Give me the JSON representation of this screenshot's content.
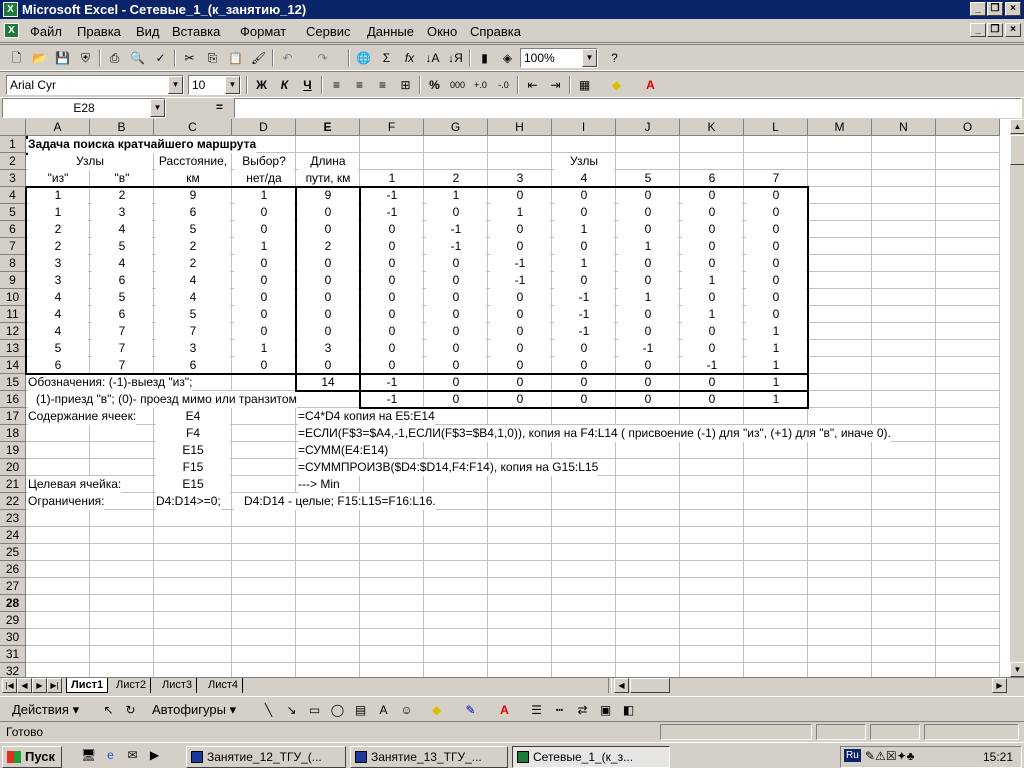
{
  "window": {
    "title": "Microsoft Excel - Сетевые_1_(к_занятию_12)",
    "app_icon": "excel-icon",
    "controls": [
      "_",
      "❐",
      "×"
    ]
  },
  "menu": [
    "Файл",
    "Правка",
    "Вид",
    "Вставка",
    "Формат",
    "Сервис",
    "Данные",
    "Окно",
    "Справка"
  ],
  "toolbar": {
    "zoom": "100%"
  },
  "format_toolbar": {
    "font": "Arial Cyr",
    "size": "10",
    "bold": "Ж",
    "italic": "К",
    "underline": "Ч",
    "percent": "%",
    "thousands": "000"
  },
  "formula_bar": {
    "name_box": "E28",
    "equals": "=",
    "content": ""
  },
  "columns": [
    "A",
    "B",
    "C",
    "D",
    "E",
    "F",
    "G",
    "H",
    "I",
    "J",
    "K",
    "L",
    "M",
    "N",
    "O"
  ],
  "selected_column": "E",
  "selected_row": "28",
  "rows": [
    "1",
    "2",
    "3",
    "4",
    "5",
    "6",
    "7",
    "8",
    "9",
    "10",
    "11",
    "12",
    "13",
    "14",
    "15",
    "16",
    "17",
    "18",
    "19",
    "20",
    "21",
    "22",
    "23",
    "24",
    "25",
    "26",
    "27",
    "28",
    "29",
    "30",
    "31",
    "32"
  ],
  "sheet": {
    "title": "Задача поиска кратчайшего маршрута",
    "header2": {
      "ab": "Узлы",
      "c": "Расстояние,",
      "d": "Выбор?",
      "e": "Длина",
      "i": "Узлы"
    },
    "header3": {
      "a": "\"из\"",
      "b": "\"в\"",
      "c": "км",
      "d": "нет/да",
      "e": "пути, км",
      "nodes": [
        "1",
        "2",
        "3",
        "4",
        "5",
        "6",
        "7"
      ]
    },
    "data": [
      [
        "1",
        "2",
        "9",
        "1",
        "9",
        "-1",
        "1",
        "0",
        "0",
        "0",
        "0",
        "0"
      ],
      [
        "1",
        "3",
        "6",
        "0",
        "0",
        "-1",
        "0",
        "1",
        "0",
        "0",
        "0",
        "0"
      ],
      [
        "2",
        "4",
        "5",
        "0",
        "0",
        "0",
        "-1",
        "0",
        "1",
        "0",
        "0",
        "0"
      ],
      [
        "2",
        "5",
        "2",
        "1",
        "2",
        "0",
        "-1",
        "0",
        "0",
        "1",
        "0",
        "0"
      ],
      [
        "3",
        "4",
        "2",
        "0",
        "0",
        "0",
        "0",
        "-1",
        "1",
        "0",
        "0",
        "0"
      ],
      [
        "3",
        "6",
        "4",
        "0",
        "0",
        "0",
        "0",
        "-1",
        "0",
        "0",
        "1",
        "0"
      ],
      [
        "4",
        "5",
        "4",
        "0",
        "0",
        "0",
        "0",
        "0",
        "-1",
        "1",
        "0",
        "0"
      ],
      [
        "4",
        "6",
        "5",
        "0",
        "0",
        "0",
        "0",
        "0",
        "-1",
        "0",
        "1",
        "0"
      ],
      [
        "4",
        "7",
        "7",
        "0",
        "0",
        "0",
        "0",
        "0",
        "-1",
        "0",
        "0",
        "1"
      ],
      [
        "5",
        "7",
        "3",
        "1",
        "3",
        "0",
        "0",
        "0",
        "0",
        "-1",
        "0",
        "1"
      ],
      [
        "6",
        "7",
        "6",
        "0",
        "0",
        "0",
        "0",
        "0",
        "0",
        "0",
        "-1",
        "1"
      ]
    ],
    "row15": {
      "label": "Обозначения: (-1)-выезд \"из\";",
      "e": "14",
      "vals": [
        "-1",
        "0",
        "0",
        "0",
        "0",
        "0",
        "1"
      ]
    },
    "row16": {
      "label": "(1)-приезд \"в\"; (0)- проезд мимо или транзитом",
      "vals": [
        "-1",
        "0",
        "0",
        "0",
        "0",
        "0",
        "1"
      ]
    },
    "row17": {
      "a": "Содержание ячеек:",
      "c": "E4",
      "e": "=C4*D4 копия на E5:E14"
    },
    "row18": {
      "c": "F4",
      "e": "=ЕСЛИ(F$3=$A4,-1,ЕСЛИ(F$3=$B4,1,0)), копия на F4:L14 ( присвоение (-1) для \"из\", (+1) для \"в\", иначе 0)."
    },
    "row19": {
      "c": "E15",
      "e": "=СУММ(E4:E14)"
    },
    "row20": {
      "c": "F15",
      "e": "=СУММПРОИЗВ($D4:$D14,F4:F14), копия на G15:L15"
    },
    "row21": {
      "a": "Целевая ячейка:",
      "c": "E15",
      "e": "---> Min"
    },
    "row22": {
      "a": "Ограничения:",
      "c": "D4:D14>=0;",
      "d": "D4:D14 - целые;  F15:L15=F16:L16."
    }
  },
  "sheet_tabs": [
    "Лист1",
    "Лист2",
    "Лист3",
    "Лист4"
  ],
  "active_tab": "Лист1",
  "draw_toolbar": {
    "actions": "Действия",
    "autoshapes": "Автофигуры"
  },
  "status": "Готово",
  "taskbar": {
    "start": "Пуск",
    "tasks": [
      "Занятие_12_ТГУ_(...",
      "Занятие_13_ТГУ_...",
      "Сетевые_1_(к_з..."
    ],
    "active": 2,
    "lang": "Ru",
    "clock": "15:21"
  }
}
